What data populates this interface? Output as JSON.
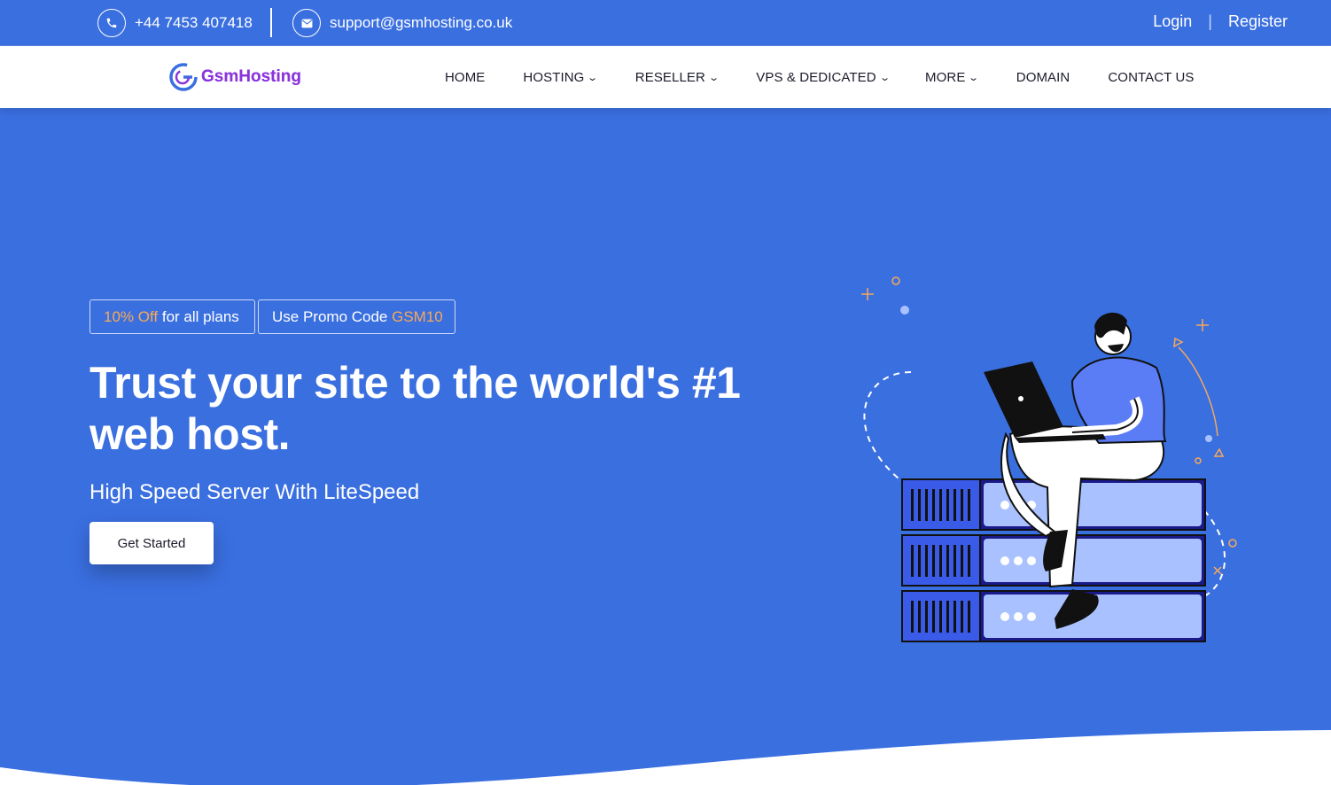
{
  "topbar": {
    "phone": "+44 7453 407418",
    "email": "support@gsmhosting.co.uk",
    "login": "Login",
    "separator": "|",
    "register": "Register"
  },
  "nav": {
    "logo_text": "GsmHosting",
    "items": [
      {
        "label": "HOME",
        "dropdown": false
      },
      {
        "label": "HOSTING",
        "dropdown": true
      },
      {
        "label": "RESELLER",
        "dropdown": true
      },
      {
        "label": "VPS & DEDICATED",
        "dropdown": true
      },
      {
        "label": "MORE",
        "dropdown": true
      },
      {
        "label": "DOMAIN",
        "dropdown": false
      },
      {
        "label": "CONTACT US",
        "dropdown": false
      }
    ]
  },
  "hero": {
    "promo1": {
      "highlight": "10% Off",
      "text": " for all plans"
    },
    "promo2": {
      "text": "Use Promo Code ",
      "highlight": "GSM10"
    },
    "headline": "Trust your site to the world's #1 web host.",
    "subheadline": "High Speed Server With LiteSpeed",
    "cta_label": "Get Started"
  },
  "colors": {
    "primary": "#3a6fe0",
    "accent": "#f7a958",
    "brand_purple": "#8a35dc",
    "white": "#ffffff",
    "text_dark": "#1b1b2b"
  }
}
